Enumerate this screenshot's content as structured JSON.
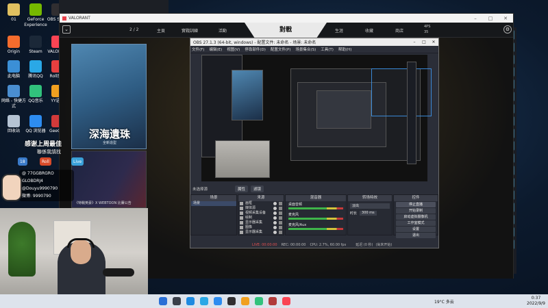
{
  "desktop": {
    "icons": [
      {
        "label": "01",
        "color": "#e0c060"
      },
      {
        "label": "GeForce Experience",
        "color": "#76b900"
      },
      {
        "label": "OBS Stu...",
        "color": "#302e31"
      },
      {
        "label": "Origin",
        "color": "#f56c2d"
      },
      {
        "label": "Steam",
        "color": "#1b2838"
      },
      {
        "label": "VALORA...",
        "color": "#fa4454"
      },
      {
        "label": "此电脑",
        "color": "#3b8fd6"
      },
      {
        "label": "腾讯QQ",
        "color": "#2aa8e6"
      },
      {
        "label": "Roll房间",
        "color": "#e63f3f"
      },
      {
        "label": "网络 - 快捷方式",
        "color": "#4a8ed0"
      },
      {
        "label": "QQ音乐",
        "color": "#31c27c"
      },
      {
        "label": "YY语音",
        "color": "#f0a020"
      },
      {
        "label": "回收站",
        "color": "#b5c3d3"
      },
      {
        "label": "QQ 浏览器",
        "color": "#2d8cf0"
      },
      {
        "label": "GeeGee",
        "color": "#d23a3a"
      }
    ]
  },
  "game": {
    "window_title": "VALORANT",
    "counter": "2 / 2",
    "nav": [
      "主頁",
      "實戰訓練",
      "活動",
      "生涯",
      "收藏",
      "商店"
    ],
    "play_tab": "對戰",
    "currency": [
      "4PS",
      "35"
    ],
    "promo1": {
      "title": "深海遺珠",
      "subtitle": "全新造型"
    },
    "promo2": {
      "caption": "《特戰英豪》X WEBTOON 比賽公告"
    }
  },
  "stream_overlay": {
    "banner": "感谢上周最佳",
    "sub_banner": "聯係我請找",
    "badges": [
      "18",
      "Roll",
      "Live"
    ],
    "socials": [
      "@ 77GGBRGRO",
      "GLOBDRJ4",
      "@Douyu9990790",
      "微博: 9990790"
    ]
  },
  "obs": {
    "title": "OBS 27.1.3 (64-bit, windows) - 配置文件: 未命名 - 场景: 未命名",
    "menu": [
      "文件(F)",
      "编辑(E)",
      "视图(V)",
      "停靠部件(D)",
      "配置文件(P)",
      "场景集合(S)",
      "工具(T)",
      "帮助(H)"
    ],
    "scene_bar": {
      "label": "未选择源",
      "props": "属性",
      "filters": "滤镜"
    },
    "panels": {
      "scenes": {
        "header": "场景",
        "items": [
          "场景"
        ]
      },
      "sources": {
        "header": "来源",
        "items": [
          "画框",
          "媒体源",
          "视频采集设备",
          "绘制",
          "显示器采集",
          "图像",
          "显示器采集"
        ]
      },
      "mixer": {
        "header": "混音器",
        "rows": [
          "桌面音频",
          "麦克风",
          "麦克风/Aux"
        ]
      },
      "transitions": {
        "header": "转场特效",
        "type": "淡出",
        "duration_label": "时长",
        "duration": "300 ms"
      },
      "controls": {
        "header": "控件",
        "buttons": [
          "停止直播",
          "开始录制",
          "启动虚拟摄像机",
          "工作室模式",
          "设置",
          "退出"
        ]
      }
    },
    "status": [
      "LIVE: 00:00:00",
      "REC: 00:00:00",
      "CPU: 2.7%, 60.00 fps",
      "延迟 (0 秒)",
      "(尚未开始)"
    ]
  },
  "taskbar": {
    "weather": "19°C 多云",
    "time": "0:37",
    "date": "2022/9/9"
  }
}
